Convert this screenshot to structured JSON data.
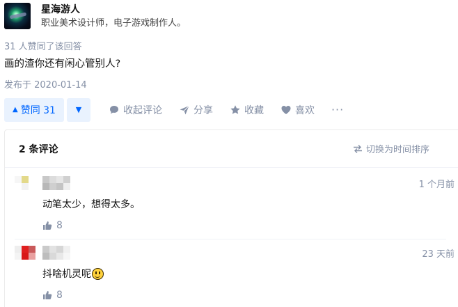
{
  "author": {
    "name": "星海游人",
    "bio": "职业美术设计师，电子游戏制作人。"
  },
  "answer": {
    "vote_summary": "31 人赞同了该回答",
    "text": "画的渣你还有闲心管别人?",
    "published": "发布于 2020-01-14"
  },
  "actions": {
    "upvote_label": "赞同 31",
    "downvote_icon": "triangle-down-icon",
    "collapse_comments": "收起评论",
    "share": "分享",
    "favorite": "收藏",
    "like": "喜欢",
    "more": "···"
  },
  "comments": {
    "count_label": "2 条评论",
    "sort_label": "切换为时间排序",
    "items": [
      {
        "time": "1 个月前",
        "text": "动笔太少，想得太多。",
        "likes": "8"
      },
      {
        "time": "23 天前",
        "text": "抖啥机灵呢",
        "emoji": "grinning-face-emoji",
        "likes": "8"
      }
    ]
  },
  "colors": {
    "accent": "#0066ff",
    "accent_bg": "#e9f2fe",
    "muted": "#8590a6"
  }
}
